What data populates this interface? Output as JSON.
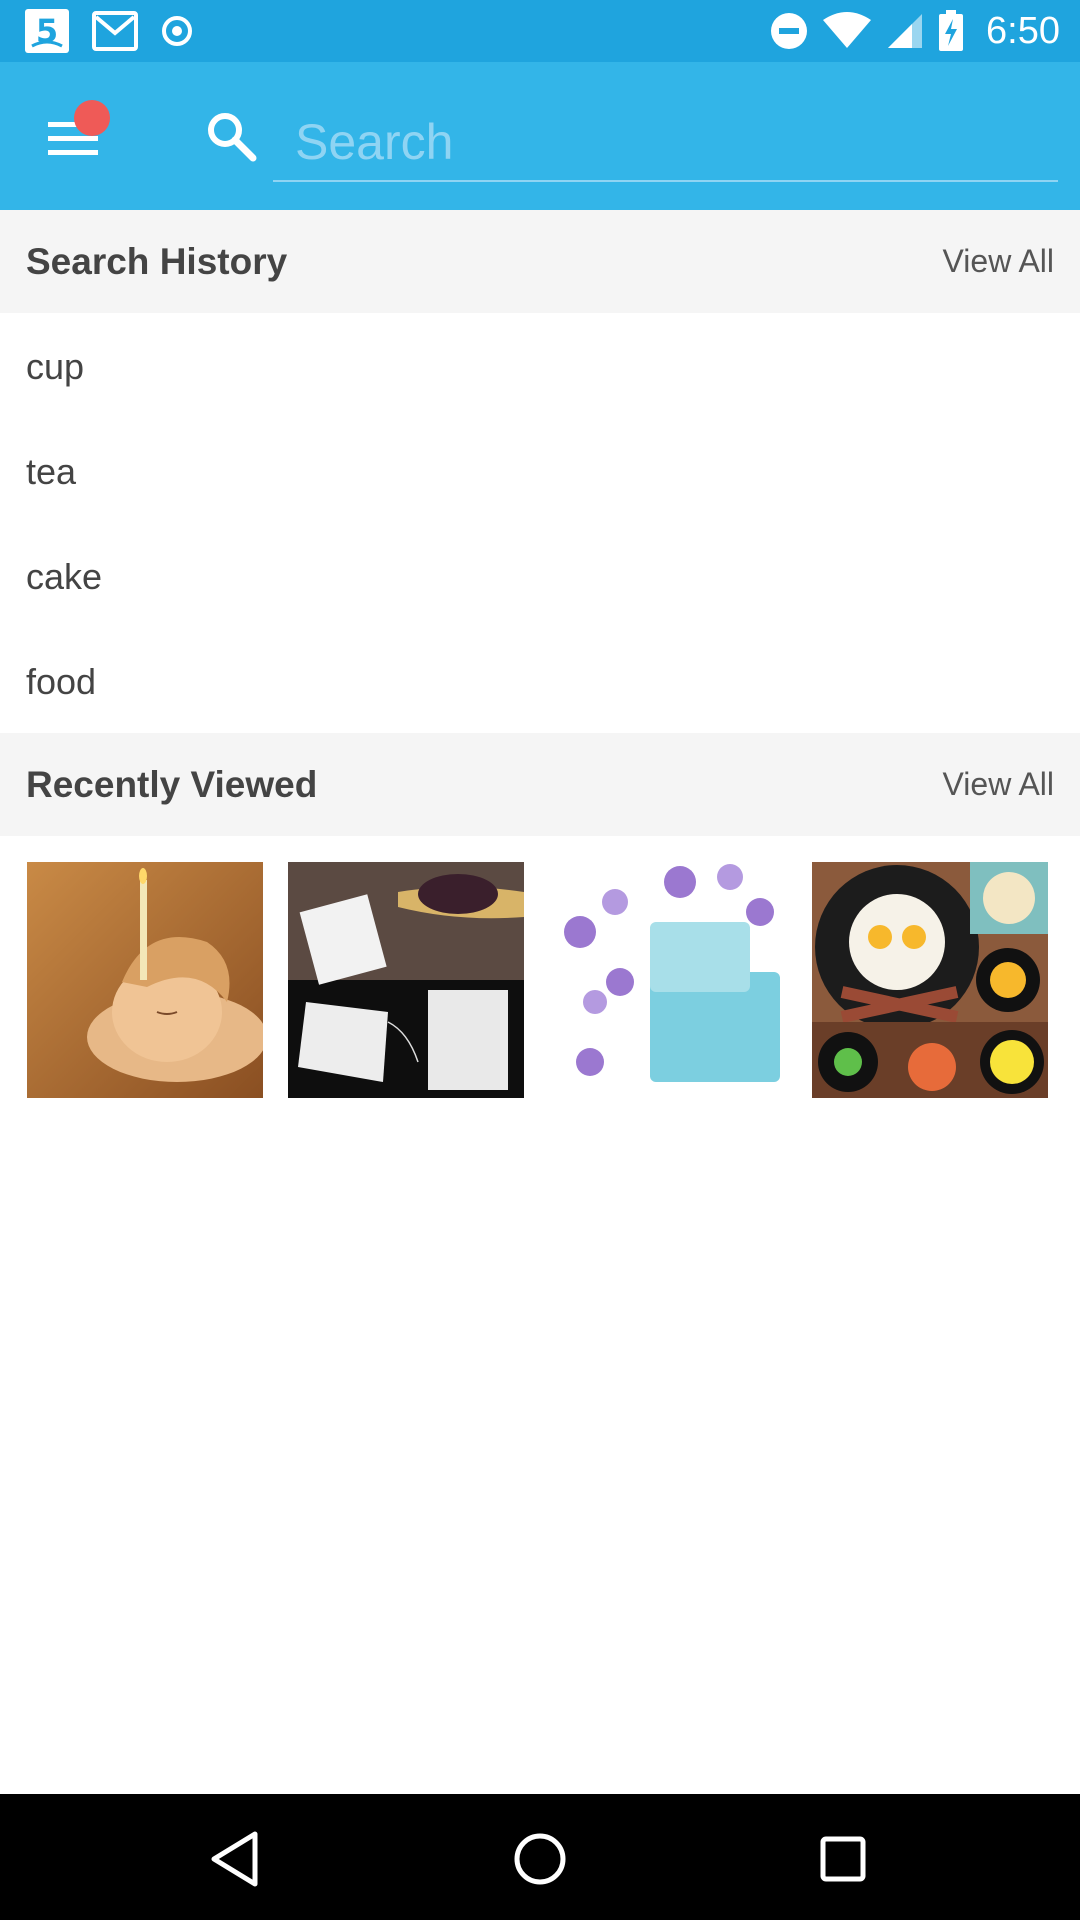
{
  "status_bar": {
    "time": "6:50",
    "left_icons": [
      "channel-5-icon",
      "gmail-icon",
      "record-icon"
    ],
    "right_icons": [
      "do-not-disturb-icon",
      "wifi-icon",
      "cell-signal-icon",
      "battery-charging-icon"
    ]
  },
  "toolbar": {
    "menu_icon": "hamburger-menu-icon",
    "has_notification_dot": true,
    "search_icon": "search-icon",
    "search_placeholder": "Search",
    "search_value": ""
  },
  "search_history": {
    "title": "Search History",
    "view_all_label": "View All",
    "items": [
      {
        "label": "cup"
      },
      {
        "label": "tea"
      },
      {
        "label": "cake"
      },
      {
        "label": "food"
      }
    ]
  },
  "recently_viewed": {
    "title": "Recently Viewed",
    "view_all_label": "View All",
    "items": [
      {
        "image": "ear-candle-spa-photo"
      },
      {
        "image": "tea-filter-bags-photo"
      },
      {
        "image": "birthday-cake-letter-cutters-photo"
      },
      {
        "image": "skull-egg-mold-frying-pan-photo"
      }
    ]
  },
  "nav_bar": {
    "buttons": [
      "back-icon",
      "home-icon",
      "recents-icon"
    ]
  },
  "colors": {
    "status_bar": "#1fa4de",
    "toolbar": "#33b5e8",
    "notification_dot": "#ef5a57",
    "section_header_bg": "#f5f5f5"
  }
}
